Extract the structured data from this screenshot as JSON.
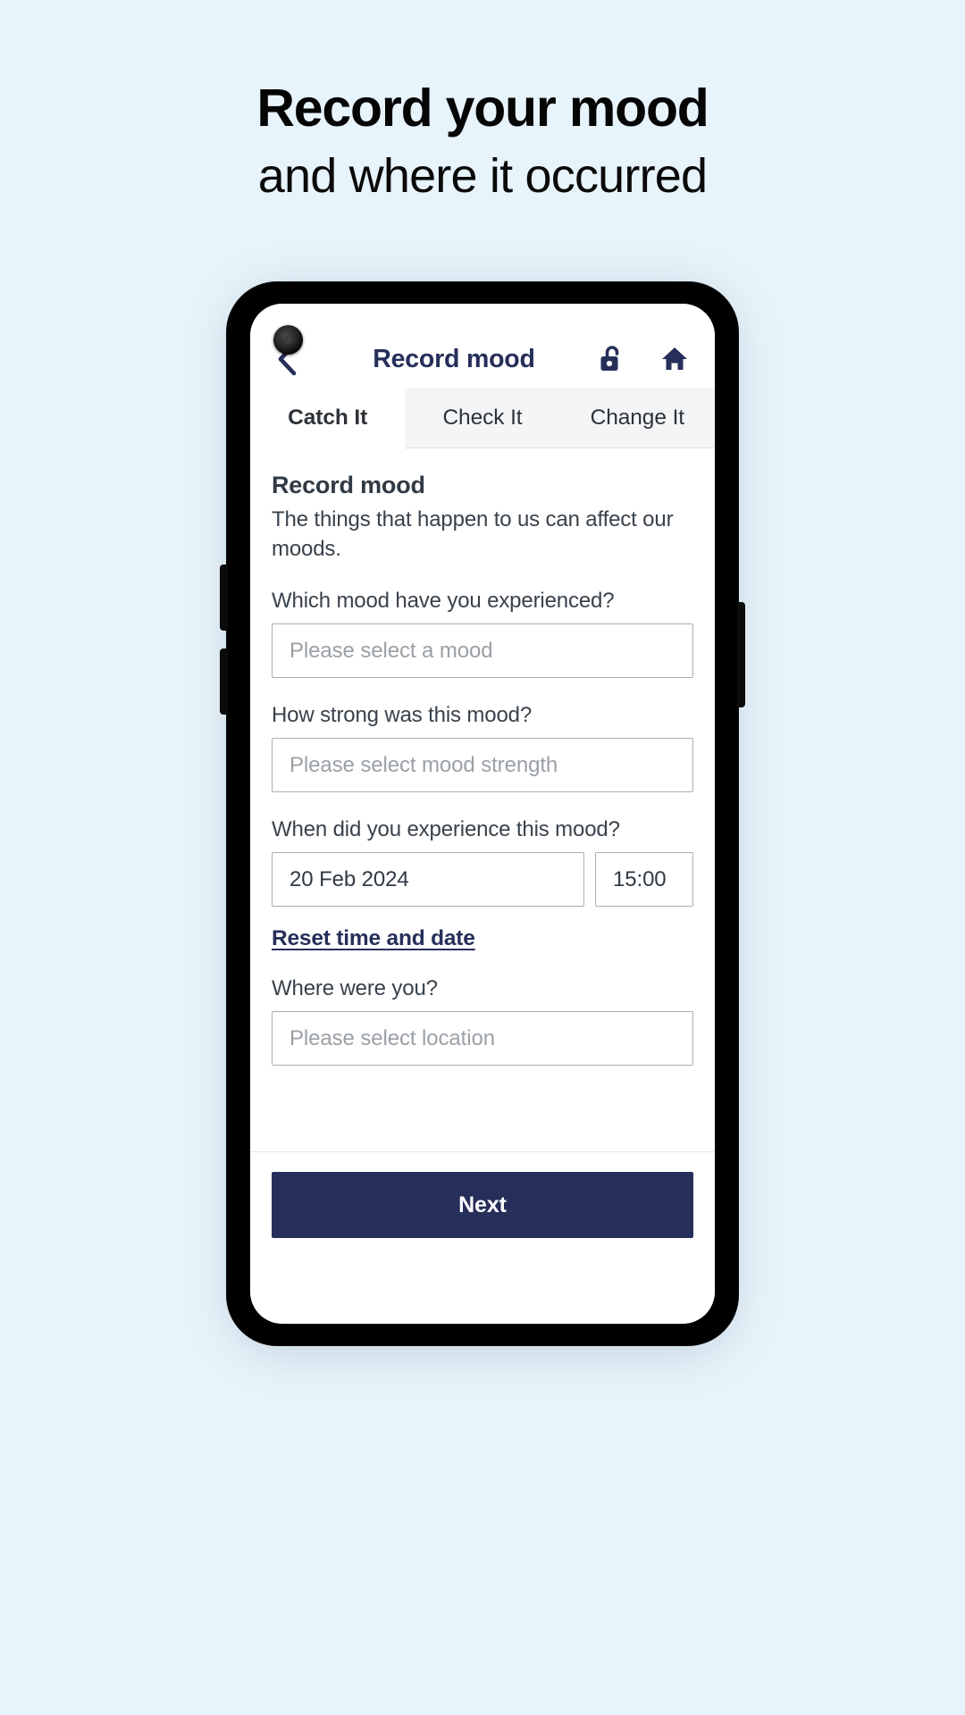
{
  "promo": {
    "title": "Record your mood",
    "subtitle": "and where it occurred"
  },
  "colors": {
    "page_background": "#e8f4fb",
    "brand_navy": "#262f5a",
    "text_dark": "#2f3a44",
    "placeholder": "#9aa0a6",
    "tab_inactive_bg": "#f4f5f7"
  },
  "app": {
    "header": {
      "back_icon": "chevron-left-icon",
      "title": "Record mood",
      "lock_icon": "unlocked-padlock-icon",
      "home_icon": "home-icon"
    },
    "tabs": [
      {
        "label": "Catch It",
        "active": true
      },
      {
        "label": "Check It",
        "active": false
      },
      {
        "label": "Change It",
        "active": false
      }
    ],
    "form": {
      "section_title": "Record mood",
      "section_desc": "The things that happen to us can affect our moods.",
      "mood": {
        "label": "Which mood have you experienced?",
        "placeholder": "Please select a mood",
        "value": ""
      },
      "strength": {
        "label": "How strong was this mood?",
        "placeholder": "Please select mood strength",
        "value": ""
      },
      "when": {
        "label": "When did you experience this mood?",
        "date_value": "20 Feb 2024",
        "time_value": "15:00"
      },
      "reset_link": "Reset time and date",
      "location": {
        "label": "Where were you?",
        "placeholder": "Please select location",
        "value": ""
      }
    },
    "footer": {
      "next_label": "Next"
    }
  }
}
